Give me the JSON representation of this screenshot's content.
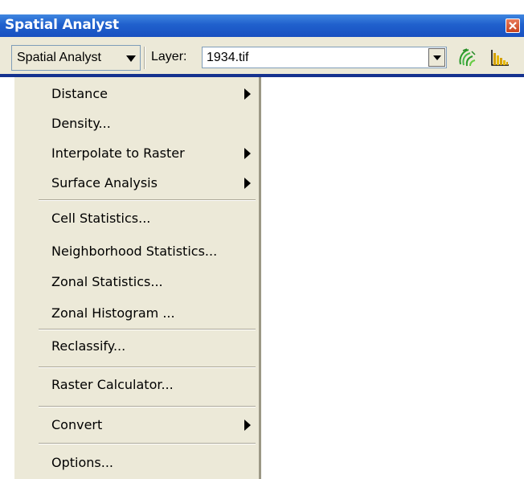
{
  "window": {
    "title": "Spatial Analyst"
  },
  "toolbar": {
    "menu_button_label": "Spatial Analyst",
    "layer_label": "Layer:",
    "layer_value": "1934.tif"
  },
  "menu": {
    "items": [
      {
        "label": "Distance",
        "submenu": true
      },
      {
        "label": "Density...",
        "submenu": false
      },
      {
        "label": "Interpolate to Raster",
        "submenu": true
      },
      {
        "label": "Surface Analysis",
        "submenu": true
      },
      {
        "label": "Cell Statistics...",
        "submenu": false
      },
      {
        "label": "Neighborhood Statistics...",
        "submenu": false
      },
      {
        "label": "Zonal Statistics...",
        "submenu": false
      },
      {
        "label": "Zonal Histogram ...",
        "submenu": false
      },
      {
        "label": "Reclassify...",
        "submenu": false
      },
      {
        "label": "Raster Calculator...",
        "submenu": false
      },
      {
        "label": "Convert",
        "submenu": true
      },
      {
        "label": "Options...",
        "submenu": false
      }
    ]
  },
  "icons": [
    "close-icon",
    "dropdown-arrow-icon",
    "contour-icon",
    "histogram-icon",
    "submenu-arrow-icon"
  ],
  "colors": {
    "titlebar": "#2060cd",
    "menu_bg": "#ece9d8",
    "toolbar_border": "#15328f"
  }
}
